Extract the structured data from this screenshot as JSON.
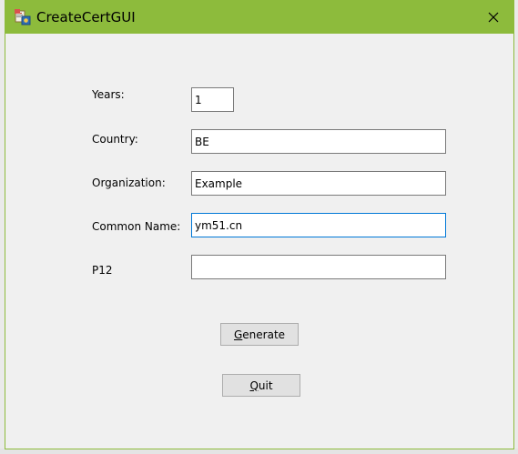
{
  "window": {
    "title": "CreateCertGUI",
    "accent_color": "#8dbb3c",
    "icon": "certificate-app-icon",
    "close_icon": "close-icon"
  },
  "form": {
    "years": {
      "label": "Years:",
      "value": "1"
    },
    "country": {
      "label": "Country:",
      "value": "BE"
    },
    "organization": {
      "label": "Organization:",
      "value": "Example"
    },
    "common_name": {
      "label": "Common Name:",
      "value": "ym51.cn"
    },
    "p12": {
      "label": "P12",
      "value": ""
    }
  },
  "buttons": {
    "generate": {
      "mnemonic": "G",
      "rest": "enerate"
    },
    "quit": {
      "mnemonic": "Q",
      "rest": "uit"
    }
  }
}
